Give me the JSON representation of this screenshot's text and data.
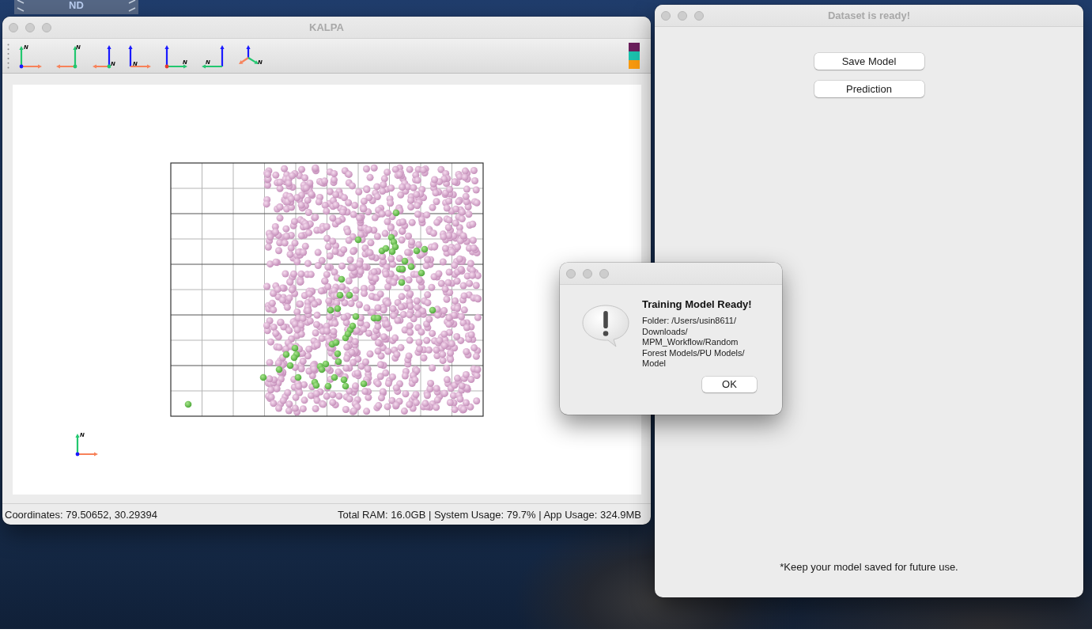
{
  "desktop": {
    "widget": {
      "label": "ND"
    }
  },
  "main_window": {
    "title": "KALPA",
    "toolbar": {
      "view_buttons": [
        {
          "kind": "top",
          "label": "N"
        },
        {
          "kind": "bottom",
          "label": "N"
        },
        {
          "kind": "front",
          "label": "N"
        },
        {
          "kind": "back",
          "label": "N"
        },
        {
          "kind": "left",
          "label": "N"
        },
        {
          "kind": "right",
          "label": "N"
        },
        {
          "kind": "iso",
          "label": "N"
        }
      ],
      "color_swatches": [
        {
          "color": "#6b1f5c"
        },
        {
          "color": "#1cc1ad"
        },
        {
          "color": "#f8990e"
        }
      ]
    },
    "canvas": {
      "north_indicator": {
        "label": "N"
      }
    },
    "status_bar": {
      "coordinates": "Coordinates: 79.50652, 30.29394",
      "memory": "Total RAM: 16.0GB | System Usage: 79.7% | App Usage: 324.9MB"
    }
  },
  "dialog": {
    "title": "Training Model Ready!",
    "message": "Folder: /Users/usin8611/\nDownloads/\nMPM_Workflow/Random\nForest Models/PU Models/\nModel",
    "buttons": [
      "OK"
    ]
  },
  "side_window": {
    "title": "Dataset is ready!",
    "buttons": [
      "Save Model",
      "Prediction"
    ],
    "note": "*Keep your model saved for future use."
  }
}
